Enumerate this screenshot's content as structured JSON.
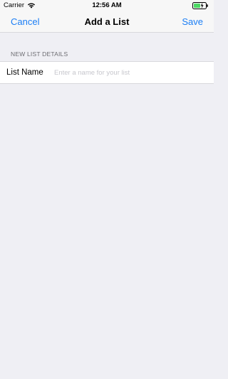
{
  "status_bar": {
    "carrier": "Carrier",
    "time": "12:56 AM",
    "wifi_icon": "wifi-icon",
    "battery_icon": "battery-charging-icon",
    "battery_color": "#4cd964"
  },
  "nav": {
    "cancel_label": "Cancel",
    "title": "Add a List",
    "save_label": "Save",
    "accent_color": "#1b7ef5"
  },
  "form": {
    "section_header": "NEW LIST DETAILS",
    "list_name_label": "List Name",
    "list_name_value": "",
    "list_name_placeholder": "Enter a name for your list"
  }
}
